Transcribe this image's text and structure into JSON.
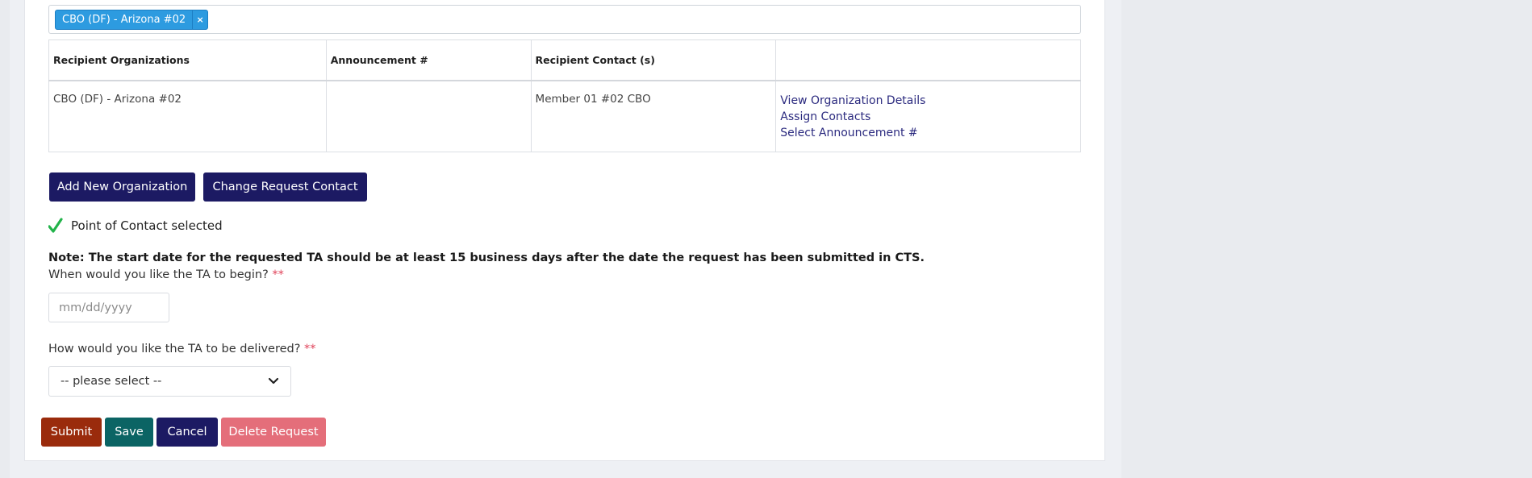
{
  "recipients_field": {
    "selected_tags": [
      {
        "label": "CBO (DF) - Arizona #02",
        "remove_glyph": "×"
      }
    ]
  },
  "table": {
    "headers": [
      "Recipient Organizations",
      "Announcement #",
      "Recipient Contact (s)",
      ""
    ],
    "rows": [
      {
        "organization": "CBO (DF) - Arizona #02",
        "announcement": "",
        "contact": "Member 01 #02 CBO",
        "actions": [
          "View Organization Details",
          "Assign Contacts",
          "Select Announcement #"
        ]
      }
    ]
  },
  "buttons": {
    "add_org": "Add New Organization",
    "change_contact": "Change Request Contact",
    "submit": "Submit",
    "save": "Save",
    "cancel": "Cancel",
    "delete": "Delete Request"
  },
  "poc_status": {
    "text": "Point of Contact selected",
    "icon": "checkmark-icon",
    "color": "#22b34a"
  },
  "note": "Note: The start date for the requested TA should be at least 15 business days after the date the request has been submitted in CTS.",
  "start_date": {
    "question": "When would you like the TA to begin?",
    "required_mark": "**",
    "value": "",
    "placeholder": "mm/dd/yyyy"
  },
  "delivery": {
    "question": "How would you like the TA to be delivered?",
    "required_mark": "**",
    "selected": "-- please select --"
  },
  "colors": {
    "navy": "#1c1a63",
    "submit": "#9a2b0c",
    "save": "#0b6464",
    "delete": "#e46e7a",
    "tag": "#2d9be0",
    "link": "#2b2a7f",
    "required": "#e0435a"
  }
}
